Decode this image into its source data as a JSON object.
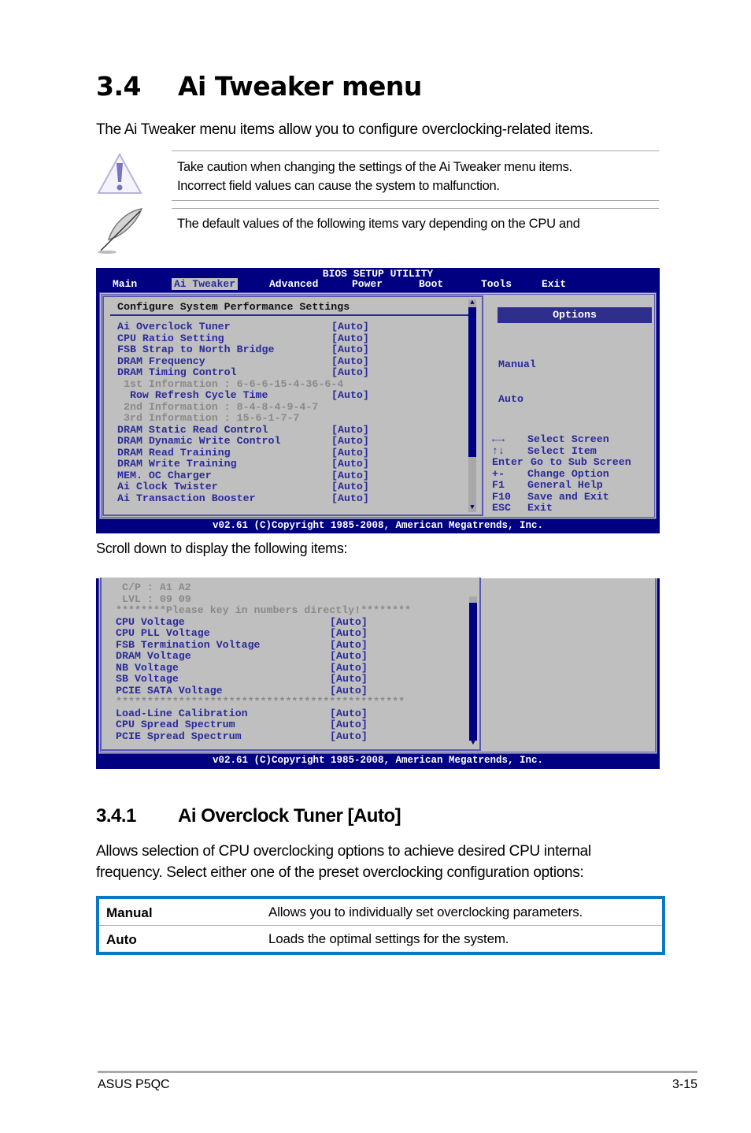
{
  "heading": {
    "number": "3.4",
    "title": "Ai Tweaker menu"
  },
  "intro": "The Ai Tweaker menu items allow you to configure overclocking-related items.",
  "notes": [
    {
      "icon": "warning-icon",
      "lines": [
        "Take caution when changing the settings of the Ai Tweaker menu items.",
        "Incorrect field values can cause the system to malfunction."
      ]
    },
    {
      "icon": "note-feather-icon",
      "lines": [
        "The default values of the following items vary depending on the CPU and"
      ]
    }
  ],
  "bios1": {
    "title": "BIOS SETUP UTILITY",
    "menu": [
      "Main",
      "Ai Tweaker",
      "Advanced",
      "Power",
      "Boot",
      "Tools",
      "Exit"
    ],
    "selected_menu": "Ai Tweaker",
    "section_title": "Configure System Performance Settings",
    "items": [
      {
        "label": "Ai Overclock Tuner",
        "value": "[Auto]",
        "style": "blue"
      },
      {
        "label": "CPU Ratio Setting",
        "value": "[Auto]",
        "style": "blue"
      },
      {
        "label": "FSB Strap to North Bridge",
        "value": "[Auto]",
        "style": "blue"
      },
      {
        "label": "DRAM Frequency",
        "value": "[Auto]",
        "style": "blue"
      },
      {
        "label": "DRAM Timing Control",
        "value": "[Auto]",
        "style": "blue"
      },
      {
        "label": " 1st Information : 6-6-6-15-4-36-6-4",
        "value": "",
        "style": "grey"
      },
      {
        "label": "  Row Refresh Cycle Time",
        "value": "[Auto]",
        "style": "blue"
      },
      {
        "label": " 2nd Information : 8-4-8-4-9-4-7",
        "value": "",
        "style": "grey"
      },
      {
        "label": " 3rd Information : 15-6-1-7-7",
        "value": "",
        "style": "grey"
      },
      {
        "label": "DRAM Static Read Control",
        "value": "[Auto]",
        "style": "blue"
      },
      {
        "label": "DRAM Dynamic Write Control",
        "value": "[Auto]",
        "style": "blue"
      },
      {
        "label": "DRAM Read Training",
        "value": "[Auto]",
        "style": "blue"
      },
      {
        "label": "DRAM Write Training",
        "value": "[Auto]",
        "style": "blue"
      },
      {
        "label": "MEM. OC Charger",
        "value": "[Auto]",
        "style": "blue"
      },
      {
        "label": "Ai Clock Twister",
        "value": "[Auto]",
        "style": "blue"
      },
      {
        "label": "Ai Transaction Booster",
        "value": "[Auto]",
        "style": "blue"
      }
    ],
    "options_title": "Options",
    "options": [
      "Manual",
      "Auto"
    ],
    "help": [
      {
        "key": "←→",
        "action": "Select Screen"
      },
      {
        "key": "↑↓",
        "action": "Select Item"
      },
      {
        "key": "Enter",
        "action": "Go to Sub Screen"
      },
      {
        "key": "+-",
        "action": "Change Option"
      },
      {
        "key": "F1",
        "action": "General Help"
      },
      {
        "key": "F10",
        "action": "Save and Exit"
      },
      {
        "key": "ESC",
        "action": "Exit"
      }
    ],
    "footer": "v02.61 (C)Copyright 1985-2008, American Megatrends, Inc."
  },
  "scroll_caption": "Scroll down to display the following items:",
  "bios2": {
    "items": [
      {
        "label": " C/P : A1 A2",
        "value": "",
        "style": "grey"
      },
      {
        "label": " LVL : 09 09",
        "value": "",
        "style": "grey"
      },
      {
        "label": "********Please key in numbers directly!********",
        "value": "",
        "style": "grey"
      },
      {
        "label": "CPU Voltage",
        "value": "[Auto]",
        "style": "blue"
      },
      {
        "label": "CPU PLL Voltage",
        "value": "[Auto]",
        "style": "blue"
      },
      {
        "label": "FSB Termination Voltage",
        "value": "[Auto]",
        "style": "blue"
      },
      {
        "label": "DRAM Voltage",
        "value": "[Auto]",
        "style": "blue"
      },
      {
        "label": "NB Voltage",
        "value": "[Auto]",
        "style": "blue"
      },
      {
        "label": "SB Voltage",
        "value": "[Auto]",
        "style": "blue"
      },
      {
        "label": "PCIE SATA Voltage",
        "value": "[Auto]",
        "style": "blue"
      },
      {
        "label": "**********************************************",
        "value": "",
        "style": "grey"
      },
      {
        "label": "Load-Line Calibration",
        "value": "[Auto]",
        "style": "blue"
      },
      {
        "label": "CPU Spread Spectrum",
        "value": "[Auto]",
        "style": "blue"
      },
      {
        "label": "PCIE Spread Spectrum",
        "value": "[Auto]",
        "style": "blue"
      }
    ],
    "footer": "v02.61 (C)Copyright 1985-2008, American Megatrends, Inc."
  },
  "subheading": {
    "number": "3.4.1",
    "title": "Ai Overclock Tuner [Auto]"
  },
  "paragraph": "Allows selection of CPU overclocking options to achieve desired CPU internal frequency. Select either one of the preset overclocking configuration options:",
  "option_table": [
    {
      "name": "Manual",
      "description": "Allows you to individually set overclocking parameters."
    },
    {
      "name": "Auto",
      "description": "Loads the optimal settings for the system."
    }
  ],
  "footer": {
    "left": "ASUS P5QC",
    "right": "3-15"
  },
  "colors": {
    "bios_blue": "#000080",
    "bios_grey": "#bfbfbf",
    "bios_text": "#2a2a9a",
    "table_border": "#0b79c0"
  }
}
